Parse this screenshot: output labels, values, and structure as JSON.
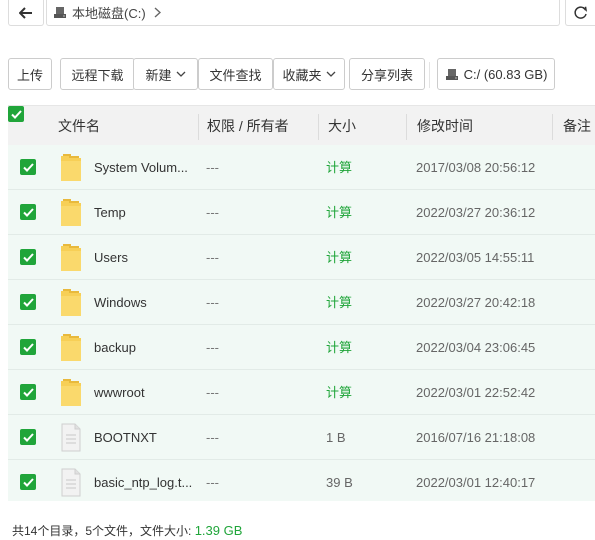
{
  "address": {
    "drive_label": "本地磁盘(C:)",
    "icons": {
      "back": "back-arrow-icon",
      "drive": "hard-drive-icon",
      "chevron": "chevron-right-icon",
      "refresh": "refresh-icon"
    }
  },
  "toolbar": {
    "upload": "上传",
    "remote_download": "远程下载",
    "new": "新建",
    "search": "文件查找",
    "favorites": "收藏夹",
    "share_list": "分享列表",
    "disk": "C:/ (60.83 GB)"
  },
  "table": {
    "columns": {
      "name": "文件名",
      "perm": "权限 / 所有者",
      "size": "大小",
      "mtime": "修改时间",
      "note": "备注"
    },
    "rows": [
      {
        "type": "folder",
        "name": "System Volum...",
        "perm": "---",
        "size": "计算",
        "mtime": "2017/03/08 20:56:12"
      },
      {
        "type": "folder",
        "name": "Temp",
        "perm": "---",
        "size": "计算",
        "mtime": "2022/03/27 20:36:12"
      },
      {
        "type": "folder",
        "name": "Users",
        "perm": "---",
        "size": "计算",
        "mtime": "2022/03/05 14:55:11"
      },
      {
        "type": "folder",
        "name": "Windows",
        "perm": "---",
        "size": "计算",
        "mtime": "2022/03/27 20:42:18"
      },
      {
        "type": "folder",
        "name": "backup",
        "perm": "---",
        "size": "计算",
        "mtime": "2022/03/04 23:06:45"
      },
      {
        "type": "folder",
        "name": "wwwroot",
        "perm": "---",
        "size": "计算",
        "mtime": "2022/03/01 22:52:42"
      },
      {
        "type": "file",
        "name": "BOOTNXT",
        "perm": "---",
        "size": "1 B",
        "mtime": "2016/07/16 21:18:08"
      },
      {
        "type": "file",
        "name": "basic_ntp_log.t...",
        "perm": "---",
        "size": "39 B",
        "mtime": "2022/03/01 12:40:17"
      }
    ]
  },
  "footer": {
    "summary": "共14个目录，5个文件，文件大小:",
    "total_size": "1.39 GB"
  },
  "colors": {
    "accent": "#20a53a",
    "row_bg": "#f1f9f5",
    "folder": "#f7c948"
  }
}
